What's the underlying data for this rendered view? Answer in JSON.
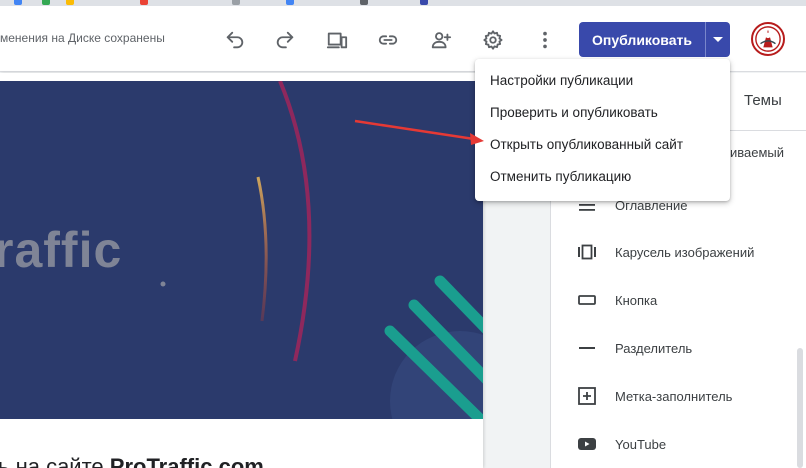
{
  "toolbar": {
    "save_status": "менения на Диске сохранены",
    "publish_label": "Опубликовать",
    "icons": [
      "undo-icon",
      "redo-icon",
      "preview-icon",
      "link-icon",
      "add-person-icon",
      "gear-icon",
      "more-vert-icon"
    ]
  },
  "publish_menu": {
    "items": [
      "Настройки публикации",
      "Проверить и опубликовать",
      "Открыть опубликованный сайт",
      "Отменить публикацию"
    ]
  },
  "canvas": {
    "hero_text": "raffic",
    "below_text_prefix": "ь на сайте ",
    "below_text_bold": "ProTraffic.com"
  },
  "side_panel": {
    "tab_themes": "Темы",
    "partial_item": "иваемый",
    "items": [
      {
        "label": "Оглавление",
        "icon": "toc-icon"
      },
      {
        "label": "Карусель изображений",
        "icon": "carousel-icon"
      },
      {
        "label": "Кнопка",
        "icon": "button-icon"
      },
      {
        "label": "Разделитель",
        "icon": "divider-icon"
      },
      {
        "label": "Метка-заполнитель",
        "icon": "placeholder-icon"
      },
      {
        "label": "YouTube",
        "icon": "youtube-icon"
      }
    ]
  },
  "colors": {
    "publish_button": "#3949ab",
    "hero_background": "#2b3a6c",
    "annotation_arrow": "#e53935"
  }
}
